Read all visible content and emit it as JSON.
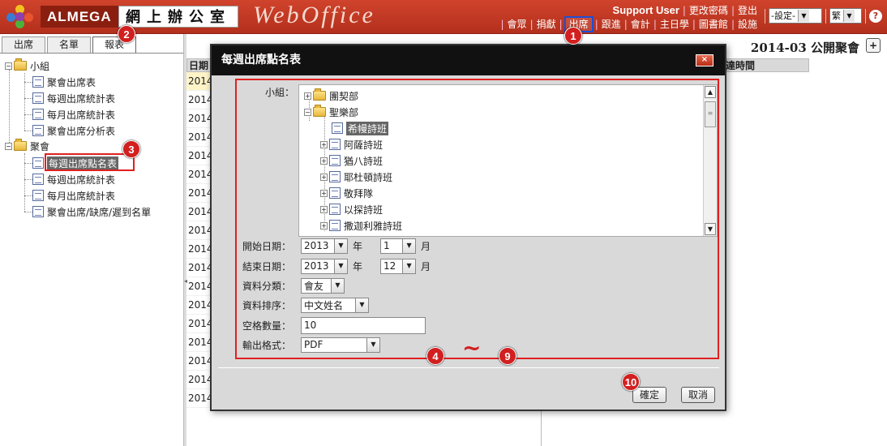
{
  "header": {
    "brand": "ALMEGA",
    "brand_cn": "網上辦公室",
    "product": "WebOffice",
    "user_name": "Support User",
    "user_links": [
      "更改密碼",
      "登出"
    ],
    "menu": [
      "會眾",
      "捐獻",
      "出席",
      "跟進",
      "會計",
      "主日學",
      "圖書館",
      "設施"
    ],
    "settings_select": "-設定-",
    "lang_select": "繁",
    "help_icon": "help-icon"
  },
  "left": {
    "tabs": [
      "出席",
      "名單",
      "報表"
    ],
    "tree": {
      "group1": "小組",
      "group1_items": [
        "聚會出席表",
        "每週出席統計表",
        "每月出席統計表",
        "聚會出席分析表"
      ],
      "group2": "聚會",
      "group2_items": [
        "每週出席點名表",
        "每週出席統計表",
        "每月出席統計表",
        "聚會出席/缺席/遲到名單"
      ]
    }
  },
  "background": {
    "title": "2014-03 公開聚會",
    "plus": "+",
    "col_date": "日期",
    "col_time": "達時間",
    "dates": [
      "2014",
      "2014",
      "2014",
      "2014",
      "2014",
      "2014",
      "2014",
      "2014",
      "2014",
      "2014",
      "2014",
      "2014",
      "2014",
      "2014",
      "2014",
      "2014",
      "2014",
      "2014"
    ]
  },
  "modal": {
    "title": "每週出席點名表",
    "close": "×",
    "group_label": "小組：",
    "tree_items": [
      "團契部",
      "聖樂部",
      "希幔詩班",
      "阿薩詩班",
      "猶八詩班",
      "耶杜頓詩班",
      "敬拜隊",
      "以探詩班",
      "撒迦利雅詩班"
    ],
    "start_label": "開始日期：",
    "start_year": "2013",
    "start_month": "1",
    "end_label": "結束日期：",
    "end_year": "2013",
    "end_month": "12",
    "year_unit": "年",
    "month_unit": "月",
    "category_label": "資料分類：",
    "category_value": "會友",
    "sort_label": "資料排序：",
    "sort_value": "中文姓名",
    "blank_label": "空格數量：",
    "blank_value": "10",
    "format_label": "輸出格式：",
    "format_value": "PDF",
    "ok": "確定",
    "cancel": "取消"
  },
  "annotations": {
    "b1": "1",
    "b2": "2",
    "b3": "3",
    "b4": "4",
    "b9": "9",
    "b10": "10",
    "tilde": "~"
  },
  "colors": {
    "header": "#c23a25",
    "highlight": "#e02020",
    "badge": "#d21f1f",
    "active_menu_outline": "#1a4fd8"
  }
}
